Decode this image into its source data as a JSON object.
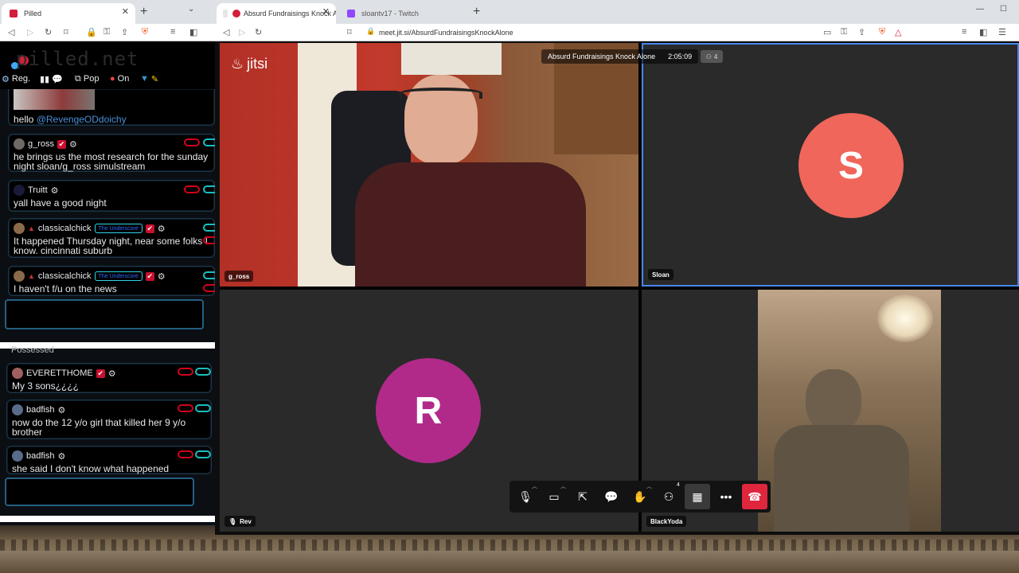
{
  "left_browser": {
    "tab_title": "Pilled",
    "tab_close": "✕",
    "new_tab": "+"
  },
  "pilled": {
    "logo_text": "pilled.net",
    "toolbar": {
      "reg": "Reg.",
      "pop": "Pop",
      "on": "On"
    },
    "messages": [
      {
        "text_pre": "hello",
        "mention": "@RevengeODdoichy"
      },
      {
        "user": "g_ross",
        "text": "he brings us the most research for the sunday night sloan/g_ross simulstream"
      },
      {
        "user": "Truitt",
        "text": "yall have a good night"
      },
      {
        "user": "classicalchick",
        "badge": "The Underscore",
        "text": "It happened Thursday night, near some folks I know. cincinnati suburb"
      },
      {
        "user": "classicalchick",
        "badge": "The Underscore",
        "text": "I haven't f/u on the news"
      }
    ],
    "messages2": [
      {
        "text": "Possessed"
      },
      {
        "user": "EVERETTHOME",
        "text": "My 3 sons¿¿¿¿"
      },
      {
        "user": "badfish",
        "text": "now do the 12 y/o girl that killed her 9 y/o brother"
      },
      {
        "user": "badfish",
        "text": "she said I don't know what happened"
      }
    ]
  },
  "right_browser": {
    "tabs": [
      {
        "title": "Absurd Fundraisings Knock Al"
      },
      {
        "title": "sloantv17 - Twitch"
      }
    ],
    "new_tab": "+",
    "url": "meet.jit.si/AbsurdFundraisingsKnockAlone"
  },
  "jitsi": {
    "logo": "jitsi",
    "meeting_title": "Absurd Fundraisings Knock Alone",
    "timer": "2:05:09",
    "participant_count": "4",
    "participants": [
      {
        "name": "g_ross"
      },
      {
        "name": "Sloan",
        "initial": "S",
        "color": "#f0665a"
      },
      {
        "name": "Rev",
        "initial": "R",
        "color": "#b12a8a"
      },
      {
        "name": "BlackYoda"
      }
    ],
    "toolbar_badge": "4",
    "hangup_color": "#e0263d"
  }
}
